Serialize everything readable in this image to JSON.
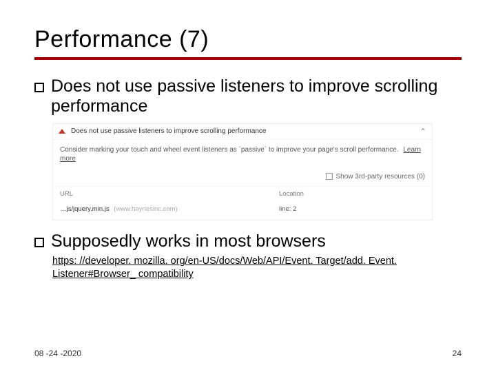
{
  "title": "Performance (7)",
  "bullets": {
    "b1": "Does not use passive listeners to improve scrolling performance",
    "b2": "Supposedly works in most browsers"
  },
  "link": "https: //developer. mozilla. org/en-US/docs/Web/API/Event. Target/add. Event. Listener#Browser_ compatibility",
  "panel": {
    "heading": "Does not use passive listeners to improve scrolling performance",
    "description": "Consider marking your touch and wheel event listeners as `passive` to improve your page's scroll performance.",
    "learn_more": "Learn more",
    "show_third_party": "Show 3rd-party resources (0)",
    "headers": {
      "url": "URL",
      "location": "Location"
    },
    "row": {
      "url": "…js/jquery.min.js",
      "host": "(www.haynesinc.com)",
      "location": "line: 2"
    }
  },
  "footer": {
    "date": "08 -24 -2020",
    "page": "24"
  }
}
